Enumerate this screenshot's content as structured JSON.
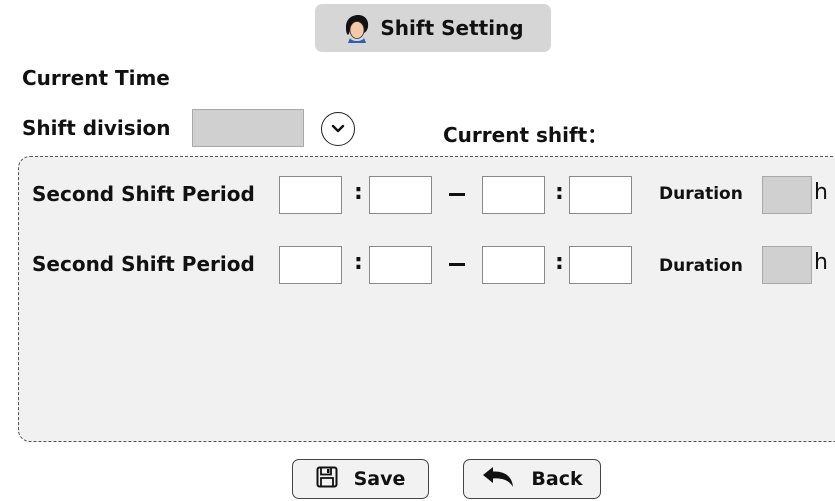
{
  "header": {
    "title": "Shift Setting",
    "icon": "person-face-icon"
  },
  "labels": {
    "current_time": "Current Time",
    "shift_division": "Shift division",
    "current_shift": "Current shift："
  },
  "shift_rows": [
    {
      "label": "Second Shift Period",
      "colon1": ":",
      "colon2": ":",
      "duration_label": "Duration",
      "unit": "h"
    },
    {
      "label": "Second Shift Period",
      "colon1": ":",
      "colon2": ":",
      "duration_label": "Duration",
      "unit": "h"
    }
  ],
  "buttons": {
    "save": {
      "label": "Save",
      "icon": "floppy-disk-icon"
    },
    "back": {
      "label": "Back",
      "icon": "undo-arrow-icon"
    }
  },
  "colors": {
    "header_bg": "#d6d6d6",
    "panel_bg": "#f1f1f1",
    "field_gray": "#d0d0d0"
  }
}
